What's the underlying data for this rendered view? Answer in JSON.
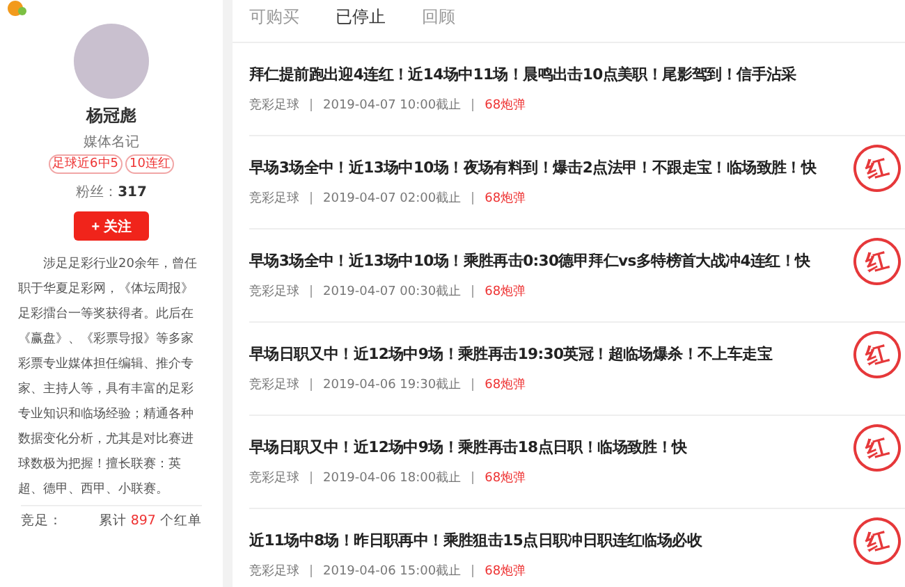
{
  "profile": {
    "name": "杨冠彪",
    "role": "媒体名记",
    "tags": [
      "足球近6中5",
      "10连红"
    ],
    "fans_label": "粉丝：",
    "fans": "317",
    "follow_button": "+ 关注",
    "bio": "涉足足彩行业20余年，曾任职于华夏足彩网，《体坛周报》足彩擂台一等奖获得者。此后在《赢盘》、《彩票导报》等多家彩票专业媒体担任编辑、推介专家、主持人等，具有丰富的足彩专业知识和临场经验；精通各种数据变化分析，尤其是对比赛进球数极为把握！擅长联赛：英超、德甲、西甲、小联赛。",
    "stat_label": "竞足：",
    "stat_prefix": "累计",
    "stat_count": "897",
    "stat_suffix": "个红单"
  },
  "tabs": [
    {
      "label": "可购买",
      "selected": false
    },
    {
      "label": "已停止",
      "selected": true
    },
    {
      "label": "回顾",
      "selected": false
    }
  ],
  "articles": [
    {
      "title": "拜仁提前跑出迎4连红！近14场中11场！晨鸣出击10点美职！尾影驾到！信手沾采",
      "category": "竞彩足球",
      "deadline": "2019-04-07 10:00截止",
      "price": "68炮弹"
    },
    {
      "title": "早场3场全中！近13场中10场！夜场有料到！爆击2点法甲！不跟走宝！临场致胜！快",
      "category": "竞彩足球",
      "deadline": "2019-04-07 02:00截止",
      "price": "68炮弹",
      "stamp": "红"
    },
    {
      "title": "早场3场全中！近13场中10场！乘胜再击0:30德甲拜仁vs多特榜首大战冲4连红！快",
      "category": "竞彩足球",
      "deadline": "2019-04-07 00:30截止",
      "price": "68炮弹",
      "stamp": "红"
    },
    {
      "title": "早场日职又中！近12场中9场！乘胜再击19:30英冠！超临场爆杀！不上车走宝",
      "category": "竞彩足球",
      "deadline": "2019-04-06 19:30截止",
      "price": "68炮弹",
      "stamp": "红"
    },
    {
      "title": "早场日职又中！近12场中9场！乘胜再击18点日职！临场致胜！快",
      "category": "竞彩足球",
      "deadline": "2019-04-06 18:00截止",
      "price": "68炮弹",
      "stamp": "红"
    },
    {
      "title": "近11场中8场！昨日职再中！乘胜狙击15点日职冲日职连红临场必收",
      "category": "竞彩足球",
      "deadline": "2019-04-06 15:00截止",
      "price": "68炮弹",
      "stamp": "红"
    }
  ]
}
